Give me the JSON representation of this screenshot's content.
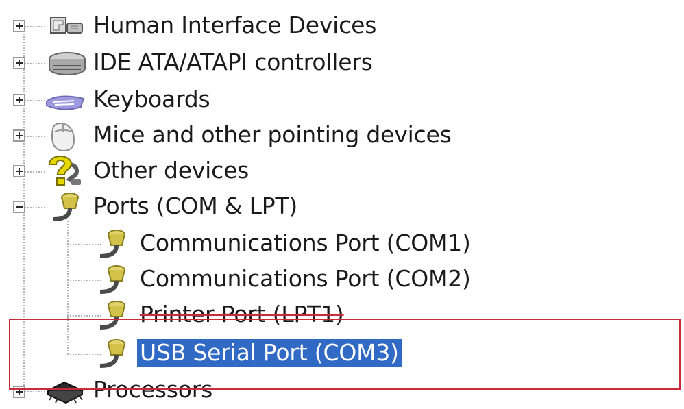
{
  "device_tree": {
    "items": [
      {
        "label": "Human Interface Devices",
        "icon": "hid-icon",
        "expander": "+"
      },
      {
        "label": "IDE ATA/ATAPI controllers",
        "icon": "ide-controller-icon",
        "expander": "+"
      },
      {
        "label": "Keyboards",
        "icon": "keyboard-icon",
        "expander": "+"
      },
      {
        "label": "Mice and other pointing devices",
        "icon": "mouse-icon",
        "expander": "+"
      },
      {
        "label": "Other devices",
        "icon": "unknown-device-icon",
        "expander": "+"
      },
      {
        "label": "Ports (COM & LPT)",
        "icon": "port-icon",
        "expander": "−",
        "children": [
          {
            "label": "Communications Port (COM1)",
            "icon": "port-icon"
          },
          {
            "label": "Communications Port (COM2)",
            "icon": "port-icon"
          },
          {
            "label": "Printer Port (LPT1)",
            "icon": "port-icon"
          },
          {
            "label": "USB Serial Port (COM3)",
            "icon": "port-icon",
            "selected": true
          }
        ]
      },
      {
        "label": "Processors",
        "icon": "processor-icon",
        "expander": "+"
      }
    ]
  },
  "colors": {
    "selection_bg": "#316ac5",
    "selection_text": "#ffffff",
    "highlight_box": "#c92a3c",
    "port_icon": "#d2c24a"
  }
}
